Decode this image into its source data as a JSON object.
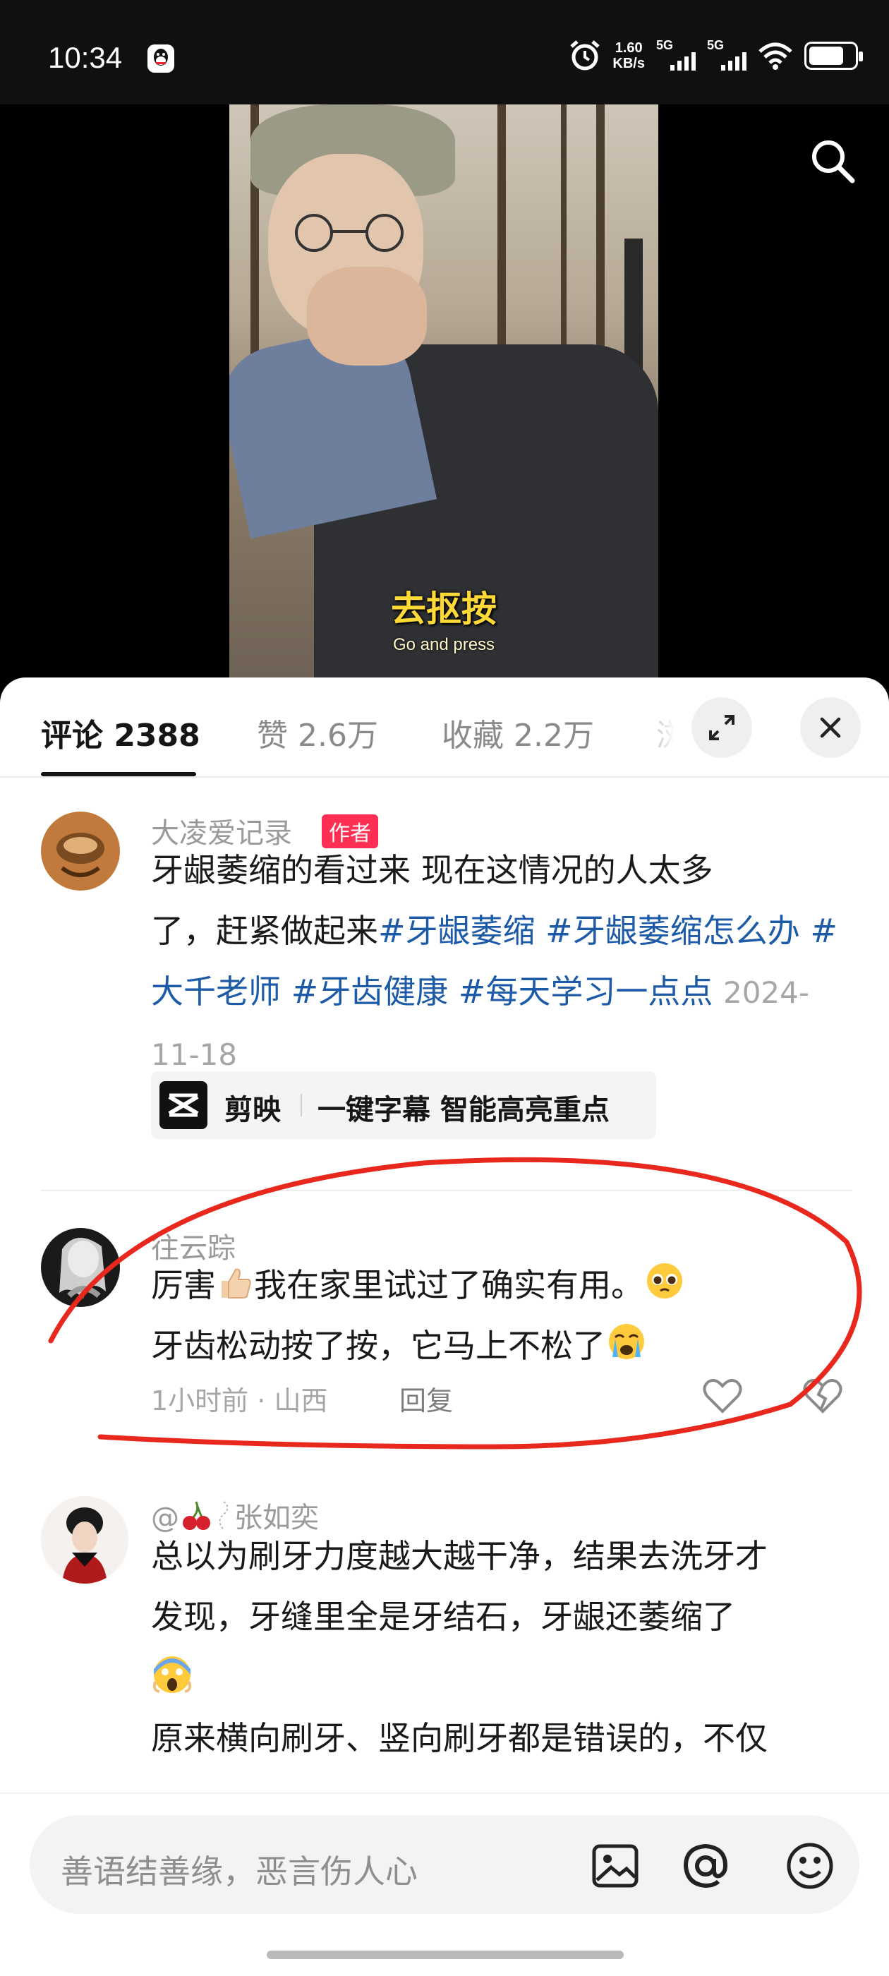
{
  "status_bar": {
    "time": "10:34",
    "net_speed_value": "1.60",
    "net_speed_unit": "KB/s",
    "sim1_label": "5G",
    "sim2_label": "5G",
    "battery_level": 0.7
  },
  "video": {
    "subtitle_cn": "去抠按",
    "subtitle_en": "Go and press"
  },
  "tabs": [
    {
      "label": "评论 2388",
      "active": true
    },
    {
      "label": "赞 2.6万",
      "active": false
    },
    {
      "label": "收藏 2.2万",
      "active": false
    },
    {
      "label": "浏",
      "active": false
    }
  ],
  "comments": [
    {
      "username": "大凌爱记录",
      "badge": "作者",
      "text_lines": [
        "牙龈萎缩的看过来 现在这情况的人太多",
        "了，赶紧做起来"
      ],
      "hashtags": [
        "#牙龈萎缩",
        "#牙龈萎缩怎么办",
        "#大千老师",
        "#牙齿健康",
        "#每天学习一点点"
      ],
      "date": "2024-11-18",
      "capcut": {
        "app": "剪映",
        "slogan": "一键字幕 智能高亮重点"
      }
    },
    {
      "username": "往云踪",
      "line1": "厉害",
      "line1b": "我在家里试过了确实有用。",
      "line2": "牙齿松动按了按，它马上不松了",
      "time": "1小时前",
      "dot": "·",
      "location": "山西",
      "reply": "回复"
    },
    {
      "username_prefix": "@",
      "username": "张如奕",
      "line1": "总以为刷牙力度越大越干净，结果去洗牙才",
      "line2": "发现，牙缝里全是牙结石，牙龈还萎缩了",
      "line3": "原来横向刷牙、竖向刷牙都是错误的，不仅"
    }
  ],
  "input": {
    "placeholder": "善语结善缘，恶言伤人心"
  },
  "colors": {
    "hashtag": "#1d5ba8",
    "author_badge": "#ff2f53",
    "annotation": "#e8271d",
    "subtitle": "#ffd938"
  }
}
